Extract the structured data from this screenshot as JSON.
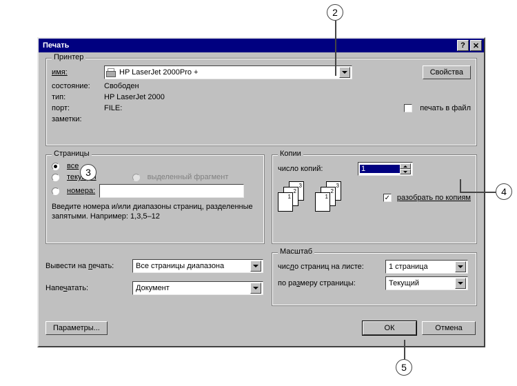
{
  "title": "Печать",
  "callouts": {
    "c2": "2",
    "c3": "3",
    "c4": "4",
    "c5": "5"
  },
  "printer_group": {
    "legend": "Принтер",
    "name_label": "имя:",
    "name_value": "HP LaserJet 2000Pro +",
    "properties_button": "Свойства",
    "state_label": "состояние:",
    "state_value": "Свободен",
    "type_label": "тип:",
    "type_value": "HP LaserJet 2000",
    "port_label": "порт:",
    "port_value": "FILE:",
    "notes_label": "заметки:",
    "print_to_file_label": "печать в файл"
  },
  "pages_group": {
    "legend": "Страницы",
    "all_label": "все",
    "current_label": "текущая",
    "selection_label": "выделенный фрагмент",
    "numbers_label": "номера:",
    "hint": "Введите номера и/или диапазоны страниц, разделенные запятыми. Например: 1,3,5–12"
  },
  "copies_group": {
    "legend": "Копии",
    "count_label": "число копий:",
    "count_value": "1",
    "collate_label": "разобрать по копиям"
  },
  "output_section": {
    "print_what_label": "Вывести на печать:",
    "print_what_value": "Все страницы диапазона",
    "print_label": "Напечатать:",
    "print_value": "Документ"
  },
  "scale_group": {
    "legend": "Масштаб",
    "pages_per_sheet_label": "число страниц на листе:",
    "pages_per_sheet_value": "1 страница",
    "size_label": "по размеру страницы:",
    "size_value": "Текущий"
  },
  "buttons": {
    "options": "Параметры...",
    "ok": "ОК",
    "cancel": "Отмена"
  }
}
